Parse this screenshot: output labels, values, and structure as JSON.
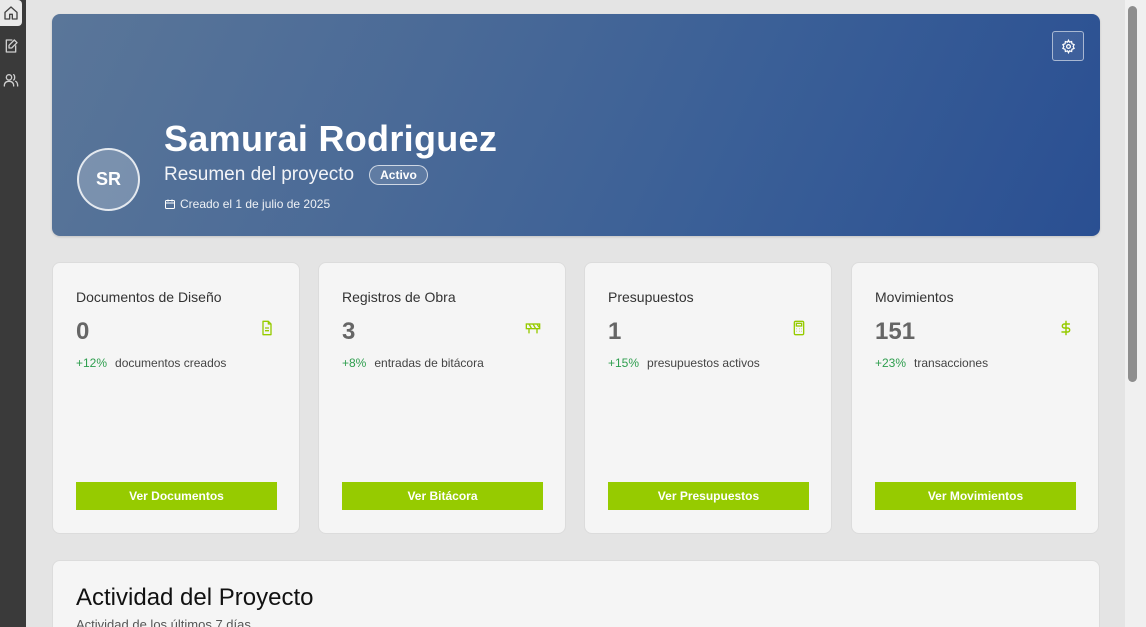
{
  "sidebar": {
    "items": [
      {
        "icon": "home-icon",
        "active": true
      },
      {
        "icon": "edit-document-icon",
        "active": false
      },
      {
        "icon": "users-icon",
        "active": false
      }
    ]
  },
  "hero": {
    "initials": "SR",
    "name": "Samurai Rodriguez",
    "subtitle": "Resumen del proyecto",
    "status": "Activo",
    "created": "Creado el 1 de julio de 2025"
  },
  "cards": [
    {
      "title": "Documentos de Diseño",
      "value": "0",
      "pct": "+12%",
      "desc": "documentos creados",
      "button": "Ver Documentos",
      "icon": "document-icon"
    },
    {
      "title": "Registros de Obra",
      "value": "3",
      "pct": "+8%",
      "desc": "entradas de bitácora",
      "button": "Ver Bitácora",
      "icon": "construction-barrier-icon"
    },
    {
      "title": "Presupuestos",
      "value": "1",
      "pct": "+15%",
      "desc": "presupuestos activos",
      "button": "Ver Presupuestos",
      "icon": "calculator-icon"
    },
    {
      "title": "Movimientos",
      "value": "151",
      "pct": "+23%",
      "desc": "transacciones",
      "button": "Ver Movimientos",
      "icon": "dollar-icon"
    }
  ],
  "activity": {
    "title": "Actividad del Proyecto",
    "subtitle": "Actividad de los últimos 7 días"
  },
  "colors": {
    "accent": "#96cb00",
    "positive": "#2e9e4e",
    "hero_start": "#5a7699",
    "hero_end": "#2a4f92"
  }
}
